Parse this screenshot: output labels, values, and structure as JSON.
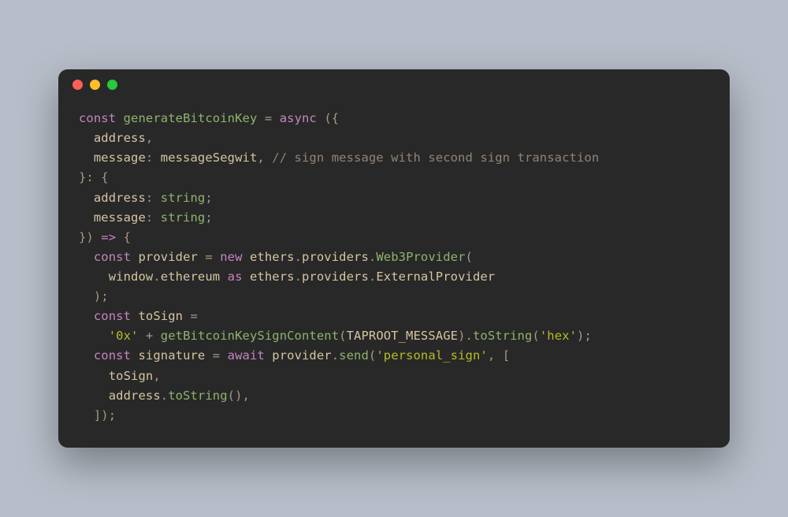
{
  "window": {
    "traffic_lights": [
      "close",
      "minimize",
      "zoom"
    ]
  },
  "code": {
    "lines": [
      [
        {
          "cls": "kw",
          "t": "const"
        },
        {
          "cls": "id",
          "t": " "
        },
        {
          "cls": "fn",
          "t": "generateBitcoinKey"
        },
        {
          "cls": "id",
          "t": " "
        },
        {
          "cls": "punct",
          "t": "="
        },
        {
          "cls": "id",
          "t": " "
        },
        {
          "cls": "kw",
          "t": "async"
        },
        {
          "cls": "id",
          "t": " "
        },
        {
          "cls": "punct",
          "t": "({"
        }
      ],
      [
        {
          "cls": "id",
          "t": "  address"
        },
        {
          "cls": "punct",
          "t": ","
        }
      ],
      [
        {
          "cls": "id",
          "t": "  message"
        },
        {
          "cls": "punct",
          "t": ": "
        },
        {
          "cls": "id",
          "t": "messageSegwit"
        },
        {
          "cls": "punct",
          "t": ", "
        },
        {
          "cls": "cmt",
          "t": "// sign message with second sign transaction"
        }
      ],
      [
        {
          "cls": "punct",
          "t": "}: {"
        }
      ],
      [
        {
          "cls": "id",
          "t": "  address"
        },
        {
          "cls": "punct",
          "t": ": "
        },
        {
          "cls": "type",
          "t": "string"
        },
        {
          "cls": "punct",
          "t": ";"
        }
      ],
      [
        {
          "cls": "id",
          "t": "  message"
        },
        {
          "cls": "punct",
          "t": ": "
        },
        {
          "cls": "type",
          "t": "string"
        },
        {
          "cls": "punct",
          "t": ";"
        }
      ],
      [
        {
          "cls": "punct",
          "t": "}) "
        },
        {
          "cls": "kw",
          "t": "=>"
        },
        {
          "cls": "punct",
          "t": " {"
        }
      ],
      [
        {
          "cls": "id",
          "t": "  "
        },
        {
          "cls": "kw",
          "t": "const"
        },
        {
          "cls": "id",
          "t": " provider "
        },
        {
          "cls": "punct",
          "t": "= "
        },
        {
          "cls": "new",
          "t": "new"
        },
        {
          "cls": "id",
          "t": " ethers"
        },
        {
          "cls": "punct",
          "t": "."
        },
        {
          "cls": "id",
          "t": "providers"
        },
        {
          "cls": "punct",
          "t": "."
        },
        {
          "cls": "fn",
          "t": "Web3Provider"
        },
        {
          "cls": "punct",
          "t": "("
        }
      ],
      [
        {
          "cls": "id",
          "t": "    window"
        },
        {
          "cls": "punct",
          "t": "."
        },
        {
          "cls": "id",
          "t": "ethereum "
        },
        {
          "cls": "kw",
          "t": "as"
        },
        {
          "cls": "id",
          "t": " ethers"
        },
        {
          "cls": "punct",
          "t": "."
        },
        {
          "cls": "id",
          "t": "providers"
        },
        {
          "cls": "punct",
          "t": "."
        },
        {
          "cls": "id",
          "t": "ExternalProvider"
        }
      ],
      [
        {
          "cls": "punct",
          "t": "  );"
        }
      ],
      [
        {
          "cls": "id",
          "t": "  "
        },
        {
          "cls": "kw",
          "t": "const"
        },
        {
          "cls": "id",
          "t": " toSign "
        },
        {
          "cls": "punct",
          "t": "="
        }
      ],
      [
        {
          "cls": "id",
          "t": "    "
        },
        {
          "cls": "str",
          "t": "'0x'"
        },
        {
          "cls": "id",
          "t": " "
        },
        {
          "cls": "punct",
          "t": "+ "
        },
        {
          "cls": "fn",
          "t": "getBitcoinKeySignContent"
        },
        {
          "cls": "punct",
          "t": "("
        },
        {
          "cls": "id",
          "t": "TAPROOT_MESSAGE"
        },
        {
          "cls": "punct",
          "t": ")."
        },
        {
          "cls": "fn",
          "t": "toString"
        },
        {
          "cls": "punct",
          "t": "("
        },
        {
          "cls": "str",
          "t": "'hex'"
        },
        {
          "cls": "punct",
          "t": ");"
        }
      ],
      [
        {
          "cls": "id",
          "t": "  "
        },
        {
          "cls": "kw",
          "t": "const"
        },
        {
          "cls": "id",
          "t": " signature "
        },
        {
          "cls": "punct",
          "t": "= "
        },
        {
          "cls": "kw",
          "t": "await"
        },
        {
          "cls": "id",
          "t": " provider"
        },
        {
          "cls": "punct",
          "t": "."
        },
        {
          "cls": "fn",
          "t": "send"
        },
        {
          "cls": "punct",
          "t": "("
        },
        {
          "cls": "str",
          "t": "'personal_sign'"
        },
        {
          "cls": "punct",
          "t": ", ["
        }
      ],
      [
        {
          "cls": "id",
          "t": "    toSign"
        },
        {
          "cls": "punct",
          "t": ","
        }
      ],
      [
        {
          "cls": "id",
          "t": "    address"
        },
        {
          "cls": "punct",
          "t": "."
        },
        {
          "cls": "fn",
          "t": "toString"
        },
        {
          "cls": "punct",
          "t": "(),"
        }
      ],
      [
        {
          "cls": "punct",
          "t": "  ]);"
        }
      ]
    ]
  }
}
